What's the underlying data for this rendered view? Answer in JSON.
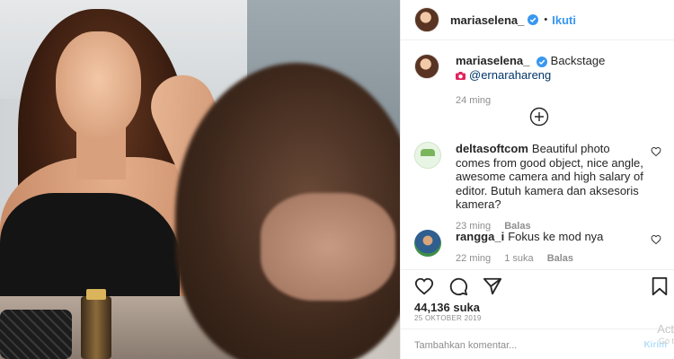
{
  "colors": {
    "accent": "#3897f0",
    "text": "#262626",
    "muted": "#8e8e8e",
    "mention": "#003569"
  },
  "header": {
    "username": "mariaselena_",
    "separator": "•",
    "follow_label": "Ikuti"
  },
  "caption": {
    "username": "mariaselena_",
    "text": "Backstage",
    "mention": "@ernarahareng",
    "time": "24 ming"
  },
  "comments": [
    {
      "username": "deltasoftcom",
      "text": "Beautiful photo comes from good object, nice angle, awesome camera and high salary of editor. Butuh kamera dan aksesoris kamera?",
      "time": "23 ming",
      "reply_label": "Balas"
    },
    {
      "username": "rangga_i",
      "text": "Fokus ke mod nya",
      "time": "22 ming",
      "likes": "1 suka",
      "reply_label": "Balas"
    }
  ],
  "post": {
    "likes": "44,136 suka",
    "date": "25 OKTOBER 2019"
  },
  "comment_box": {
    "placeholder": "Tambahkan komentar...",
    "post_label": "Kirim"
  },
  "watermark": {
    "line1": "Act",
    "line2": "Go t"
  },
  "icons": [
    "verified-icon",
    "camera-icon",
    "plus-circle-icon",
    "heart-icon",
    "comment-icon",
    "share-icon",
    "bookmark-icon"
  ]
}
